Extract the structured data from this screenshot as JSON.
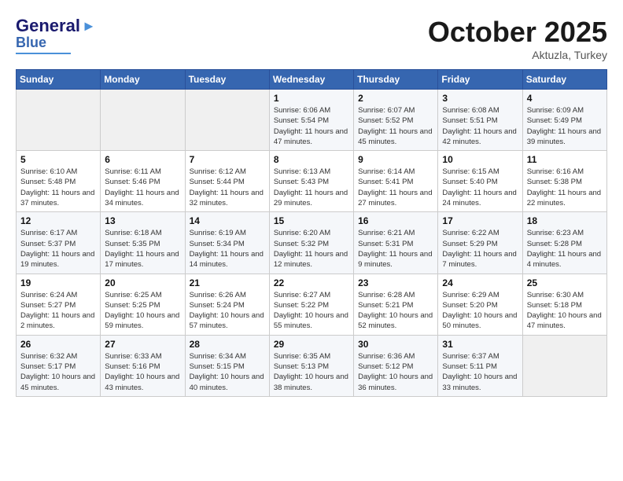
{
  "header": {
    "logo_line1": "General",
    "logo_line2": "Blue",
    "month": "October 2025",
    "location": "Aktuzla, Turkey"
  },
  "weekdays": [
    "Sunday",
    "Monday",
    "Tuesday",
    "Wednesday",
    "Thursday",
    "Friday",
    "Saturday"
  ],
  "weeks": [
    [
      {
        "day": "",
        "info": ""
      },
      {
        "day": "",
        "info": ""
      },
      {
        "day": "",
        "info": ""
      },
      {
        "day": "1",
        "info": "Sunrise: 6:06 AM\nSunset: 5:54 PM\nDaylight: 11 hours and 47 minutes."
      },
      {
        "day": "2",
        "info": "Sunrise: 6:07 AM\nSunset: 5:52 PM\nDaylight: 11 hours and 45 minutes."
      },
      {
        "day": "3",
        "info": "Sunrise: 6:08 AM\nSunset: 5:51 PM\nDaylight: 11 hours and 42 minutes."
      },
      {
        "day": "4",
        "info": "Sunrise: 6:09 AM\nSunset: 5:49 PM\nDaylight: 11 hours and 39 minutes."
      }
    ],
    [
      {
        "day": "5",
        "info": "Sunrise: 6:10 AM\nSunset: 5:48 PM\nDaylight: 11 hours and 37 minutes."
      },
      {
        "day": "6",
        "info": "Sunrise: 6:11 AM\nSunset: 5:46 PM\nDaylight: 11 hours and 34 minutes."
      },
      {
        "day": "7",
        "info": "Sunrise: 6:12 AM\nSunset: 5:44 PM\nDaylight: 11 hours and 32 minutes."
      },
      {
        "day": "8",
        "info": "Sunrise: 6:13 AM\nSunset: 5:43 PM\nDaylight: 11 hours and 29 minutes."
      },
      {
        "day": "9",
        "info": "Sunrise: 6:14 AM\nSunset: 5:41 PM\nDaylight: 11 hours and 27 minutes."
      },
      {
        "day": "10",
        "info": "Sunrise: 6:15 AM\nSunset: 5:40 PM\nDaylight: 11 hours and 24 minutes."
      },
      {
        "day": "11",
        "info": "Sunrise: 6:16 AM\nSunset: 5:38 PM\nDaylight: 11 hours and 22 minutes."
      }
    ],
    [
      {
        "day": "12",
        "info": "Sunrise: 6:17 AM\nSunset: 5:37 PM\nDaylight: 11 hours and 19 minutes."
      },
      {
        "day": "13",
        "info": "Sunrise: 6:18 AM\nSunset: 5:35 PM\nDaylight: 11 hours and 17 minutes."
      },
      {
        "day": "14",
        "info": "Sunrise: 6:19 AM\nSunset: 5:34 PM\nDaylight: 11 hours and 14 minutes."
      },
      {
        "day": "15",
        "info": "Sunrise: 6:20 AM\nSunset: 5:32 PM\nDaylight: 11 hours and 12 minutes."
      },
      {
        "day": "16",
        "info": "Sunrise: 6:21 AM\nSunset: 5:31 PM\nDaylight: 11 hours and 9 minutes."
      },
      {
        "day": "17",
        "info": "Sunrise: 6:22 AM\nSunset: 5:29 PM\nDaylight: 11 hours and 7 minutes."
      },
      {
        "day": "18",
        "info": "Sunrise: 6:23 AM\nSunset: 5:28 PM\nDaylight: 11 hours and 4 minutes."
      }
    ],
    [
      {
        "day": "19",
        "info": "Sunrise: 6:24 AM\nSunset: 5:27 PM\nDaylight: 11 hours and 2 minutes."
      },
      {
        "day": "20",
        "info": "Sunrise: 6:25 AM\nSunset: 5:25 PM\nDaylight: 10 hours and 59 minutes."
      },
      {
        "day": "21",
        "info": "Sunrise: 6:26 AM\nSunset: 5:24 PM\nDaylight: 10 hours and 57 minutes."
      },
      {
        "day": "22",
        "info": "Sunrise: 6:27 AM\nSunset: 5:22 PM\nDaylight: 10 hours and 55 minutes."
      },
      {
        "day": "23",
        "info": "Sunrise: 6:28 AM\nSunset: 5:21 PM\nDaylight: 10 hours and 52 minutes."
      },
      {
        "day": "24",
        "info": "Sunrise: 6:29 AM\nSunset: 5:20 PM\nDaylight: 10 hours and 50 minutes."
      },
      {
        "day": "25",
        "info": "Sunrise: 6:30 AM\nSunset: 5:18 PM\nDaylight: 10 hours and 47 minutes."
      }
    ],
    [
      {
        "day": "26",
        "info": "Sunrise: 6:32 AM\nSunset: 5:17 PM\nDaylight: 10 hours and 45 minutes."
      },
      {
        "day": "27",
        "info": "Sunrise: 6:33 AM\nSunset: 5:16 PM\nDaylight: 10 hours and 43 minutes."
      },
      {
        "day": "28",
        "info": "Sunrise: 6:34 AM\nSunset: 5:15 PM\nDaylight: 10 hours and 40 minutes."
      },
      {
        "day": "29",
        "info": "Sunrise: 6:35 AM\nSunset: 5:13 PM\nDaylight: 10 hours and 38 minutes."
      },
      {
        "day": "30",
        "info": "Sunrise: 6:36 AM\nSunset: 5:12 PM\nDaylight: 10 hours and 36 minutes."
      },
      {
        "day": "31",
        "info": "Sunrise: 6:37 AM\nSunset: 5:11 PM\nDaylight: 10 hours and 33 minutes."
      },
      {
        "day": "",
        "info": ""
      }
    ]
  ]
}
